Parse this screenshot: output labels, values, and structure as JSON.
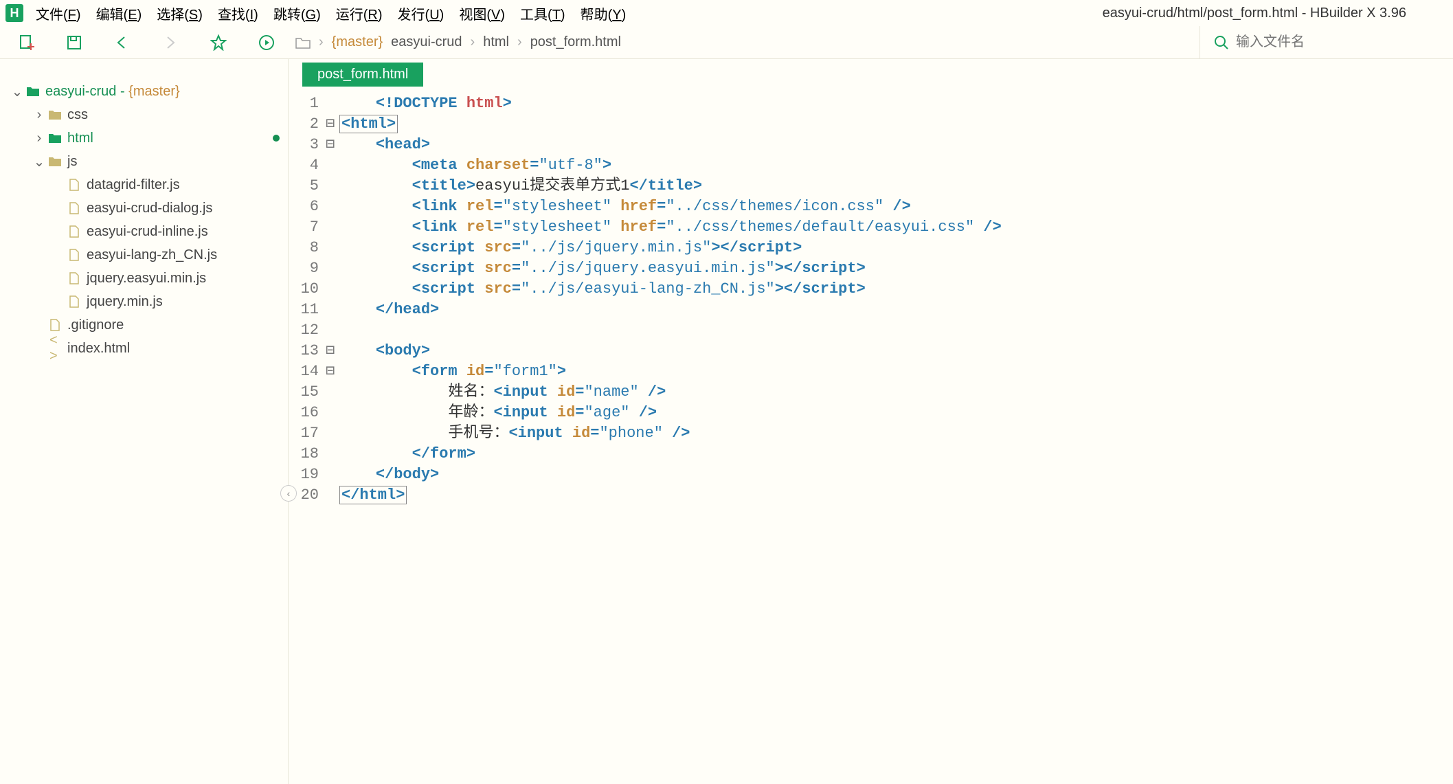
{
  "window": {
    "title": "easyui-crud/html/post_form.html - HBuilder X 3.96",
    "logo": "H"
  },
  "menu": {
    "items": [
      {
        "label": "文件",
        "key": "F"
      },
      {
        "label": "编辑",
        "key": "E"
      },
      {
        "label": "选择",
        "key": "S"
      },
      {
        "label": "查找",
        "key": "I"
      },
      {
        "label": "跳转",
        "key": "G"
      },
      {
        "label": "运行",
        "key": "R"
      },
      {
        "label": "发行",
        "key": "U"
      },
      {
        "label": "视图",
        "key": "V"
      },
      {
        "label": "工具",
        "key": "T"
      },
      {
        "label": "帮助",
        "key": "Y"
      }
    ]
  },
  "breadcrumb": {
    "branch": "{master}",
    "parts": [
      "easyui-crud",
      "html",
      "post_form.html"
    ]
  },
  "search": {
    "placeholder": "输入文件名"
  },
  "sidebar": {
    "root": {
      "name": "easyui-crud",
      "branch": "{master}"
    },
    "folders": [
      {
        "name": "css",
        "expanded": false,
        "active": false
      },
      {
        "name": "html",
        "expanded": false,
        "active": true,
        "modified": true
      },
      {
        "name": "js",
        "expanded": true,
        "active": false
      }
    ],
    "js_files": [
      "datagrid-filter.js",
      "easyui-crud-dialog.js",
      "easyui-crud-inline.js",
      "easyui-lang-zh_CN.js",
      "jquery.easyui.min.js",
      "jquery.min.js"
    ],
    "root_files": [
      {
        "name": ".gitignore",
        "icon": "file"
      },
      {
        "name": "index.html",
        "icon": "code"
      }
    ]
  },
  "tabs": [
    {
      "name": "post_form.html",
      "active": true
    }
  ],
  "editor": {
    "lines": [
      {
        "n": 1,
        "fold": "",
        "indent": 1,
        "boxed": false,
        "tokens": [
          [
            "tag-delim",
            "<!"
          ],
          [
            "tag",
            "DOCTYPE "
          ],
          [
            "doctype-name",
            "html"
          ],
          [
            "tag-delim",
            ">"
          ]
        ]
      },
      {
        "n": 2,
        "fold": "⊟",
        "indent": 0,
        "boxed": true,
        "tokens": [
          [
            "tag-delim",
            "<"
          ],
          [
            "tag",
            "html"
          ],
          [
            "tag-delim",
            ">"
          ]
        ]
      },
      {
        "n": 3,
        "fold": "⊟",
        "indent": 1,
        "boxed": false,
        "tokens": [
          [
            "tag-delim",
            "<"
          ],
          [
            "tag",
            "head"
          ],
          [
            "tag-delim",
            ">"
          ]
        ]
      },
      {
        "n": 4,
        "fold": "",
        "indent": 2,
        "boxed": false,
        "tokens": [
          [
            "tag-delim",
            "<"
          ],
          [
            "tag",
            "meta "
          ],
          [
            "attr",
            "charset"
          ],
          [
            "tag-delim",
            "="
          ],
          [
            "val",
            "\"utf-8\""
          ],
          [
            "tag-delim",
            ">"
          ]
        ]
      },
      {
        "n": 5,
        "fold": "",
        "indent": 2,
        "boxed": false,
        "tokens": [
          [
            "tag-delim",
            "<"
          ],
          [
            "tag",
            "title"
          ],
          [
            "tag-delim",
            ">"
          ],
          [
            "txt",
            "easyui提交表单方式1"
          ],
          [
            "tag-delim",
            "</"
          ],
          [
            "tag",
            "title"
          ],
          [
            "tag-delim",
            ">"
          ]
        ]
      },
      {
        "n": 6,
        "fold": "",
        "indent": 2,
        "boxed": false,
        "tokens": [
          [
            "tag-delim",
            "<"
          ],
          [
            "tag",
            "link "
          ],
          [
            "attr",
            "rel"
          ],
          [
            "tag-delim",
            "="
          ],
          [
            "val",
            "\"stylesheet\" "
          ],
          [
            "attr",
            "href"
          ],
          [
            "tag-delim",
            "="
          ],
          [
            "val",
            "\"../css/themes/icon.css\" "
          ],
          [
            "tag-delim",
            "/>"
          ]
        ]
      },
      {
        "n": 7,
        "fold": "",
        "indent": 2,
        "boxed": false,
        "tokens": [
          [
            "tag-delim",
            "<"
          ],
          [
            "tag",
            "link "
          ],
          [
            "attr",
            "rel"
          ],
          [
            "tag-delim",
            "="
          ],
          [
            "val",
            "\"stylesheet\" "
          ],
          [
            "attr",
            "href"
          ],
          [
            "tag-delim",
            "="
          ],
          [
            "val",
            "\"../css/themes/default/easyui.css\" "
          ],
          [
            "tag-delim",
            "/>"
          ]
        ]
      },
      {
        "n": 8,
        "fold": "",
        "indent": 2,
        "boxed": false,
        "tokens": [
          [
            "tag-delim",
            "<"
          ],
          [
            "tag",
            "script "
          ],
          [
            "attr",
            "src"
          ],
          [
            "tag-delim",
            "="
          ],
          [
            "val",
            "\"../js/jquery.min.js\""
          ],
          [
            "tag-delim",
            "></"
          ],
          [
            "tag",
            "script"
          ],
          [
            "tag-delim",
            ">"
          ]
        ]
      },
      {
        "n": 9,
        "fold": "",
        "indent": 2,
        "boxed": false,
        "tokens": [
          [
            "tag-delim",
            "<"
          ],
          [
            "tag",
            "script "
          ],
          [
            "attr",
            "src"
          ],
          [
            "tag-delim",
            "="
          ],
          [
            "val",
            "\"../js/jquery.easyui.min.js\""
          ],
          [
            "tag-delim",
            "></"
          ],
          [
            "tag",
            "script"
          ],
          [
            "tag-delim",
            ">"
          ]
        ]
      },
      {
        "n": 10,
        "fold": "",
        "indent": 2,
        "boxed": false,
        "tokens": [
          [
            "tag-delim",
            "<"
          ],
          [
            "tag",
            "script "
          ],
          [
            "attr",
            "src"
          ],
          [
            "tag-delim",
            "="
          ],
          [
            "val",
            "\"../js/easyui-lang-zh_CN.js\""
          ],
          [
            "tag-delim",
            "></"
          ],
          [
            "tag",
            "script"
          ],
          [
            "tag-delim",
            ">"
          ]
        ]
      },
      {
        "n": 11,
        "fold": "",
        "indent": 1,
        "boxed": false,
        "tokens": [
          [
            "tag-delim",
            "</"
          ],
          [
            "tag",
            "head"
          ],
          [
            "tag-delim",
            ">"
          ]
        ]
      },
      {
        "n": 12,
        "fold": "",
        "indent": 0,
        "boxed": false,
        "tokens": []
      },
      {
        "n": 13,
        "fold": "⊟",
        "indent": 1,
        "boxed": false,
        "tokens": [
          [
            "tag-delim",
            "<"
          ],
          [
            "tag",
            "body"
          ],
          [
            "tag-delim",
            ">"
          ]
        ]
      },
      {
        "n": 14,
        "fold": "⊟",
        "indent": 2,
        "boxed": false,
        "tokens": [
          [
            "tag-delim",
            "<"
          ],
          [
            "tag",
            "form "
          ],
          [
            "attr",
            "id"
          ],
          [
            "tag-delim",
            "="
          ],
          [
            "val",
            "\"form1\""
          ],
          [
            "tag-delim",
            ">"
          ]
        ]
      },
      {
        "n": 15,
        "fold": "",
        "indent": 3,
        "boxed": false,
        "tokens": [
          [
            "txt",
            "姓名："
          ],
          [
            "tag-delim",
            "<"
          ],
          [
            "tag",
            "input "
          ],
          [
            "attr",
            "id"
          ],
          [
            "tag-delim",
            "="
          ],
          [
            "val",
            "\"name\" "
          ],
          [
            "tag-delim",
            "/>"
          ]
        ]
      },
      {
        "n": 16,
        "fold": "",
        "indent": 3,
        "boxed": false,
        "tokens": [
          [
            "txt",
            "年龄："
          ],
          [
            "tag-delim",
            "<"
          ],
          [
            "tag",
            "input "
          ],
          [
            "attr",
            "id"
          ],
          [
            "tag-delim",
            "="
          ],
          [
            "val",
            "\"age\" "
          ],
          [
            "tag-delim",
            "/>"
          ]
        ]
      },
      {
        "n": 17,
        "fold": "",
        "indent": 3,
        "boxed": false,
        "tokens": [
          [
            "txt",
            "手机号："
          ],
          [
            "tag-delim",
            "<"
          ],
          [
            "tag",
            "input "
          ],
          [
            "attr",
            "id"
          ],
          [
            "tag-delim",
            "="
          ],
          [
            "val",
            "\"phone\" "
          ],
          [
            "tag-delim",
            "/>"
          ]
        ]
      },
      {
        "n": 18,
        "fold": "",
        "indent": 2,
        "boxed": false,
        "tokens": [
          [
            "tag-delim",
            "</"
          ],
          [
            "tag",
            "form"
          ],
          [
            "tag-delim",
            ">"
          ]
        ]
      },
      {
        "n": 19,
        "fold": "",
        "indent": 1,
        "boxed": false,
        "tokens": [
          [
            "tag-delim",
            "</"
          ],
          [
            "tag",
            "body"
          ],
          [
            "tag-delim",
            ">"
          ]
        ]
      },
      {
        "n": 20,
        "fold": "",
        "indent": 0,
        "boxed": true,
        "tokens": [
          [
            "tag-delim",
            "</"
          ],
          [
            "tag",
            "html"
          ],
          [
            "tag-delim",
            ">"
          ]
        ]
      }
    ]
  }
}
